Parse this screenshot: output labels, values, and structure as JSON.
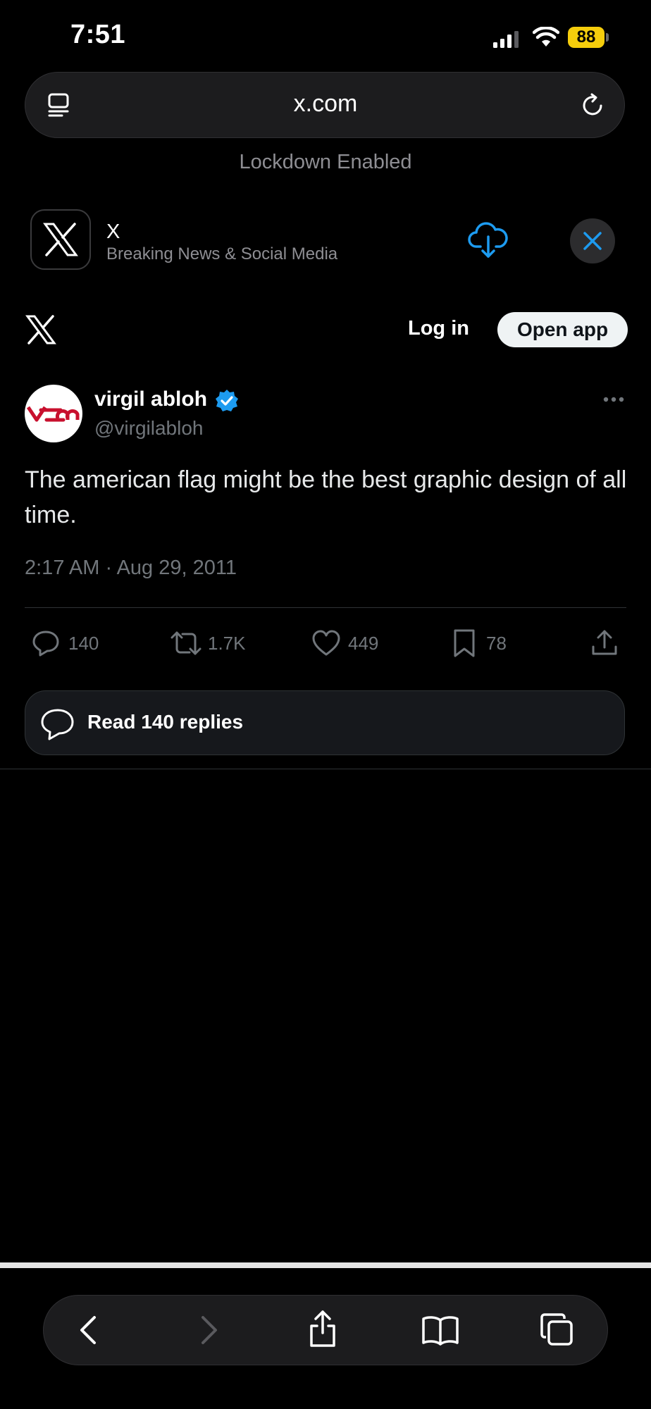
{
  "status_bar": {
    "time": "7:51",
    "battery": "88"
  },
  "browser": {
    "url": "x.com",
    "lockdown_notice": "Lockdown Enabled"
  },
  "app_banner": {
    "name": "X",
    "subtitle": "Breaking News & Social Media"
  },
  "header": {
    "login_label": "Log in",
    "open_app_label": "Open app"
  },
  "tweet": {
    "display_name": "virgil abloh",
    "handle": "@virgilabloh",
    "text": "The american flag might be the best graphic design of all time.",
    "timestamp": "2:17 AM · Aug 29, 2011",
    "stats": {
      "replies": "140",
      "reposts": "1.7K",
      "likes": "449",
      "bookmarks": "78"
    },
    "read_replies_label": "Read 140 replies"
  },
  "colors": {
    "accent_blue": "#1d9bf0",
    "verified_badge": "#1d9bf0",
    "battery": "#f5cd0c"
  },
  "icons": [
    "tabs-sidebar-icon",
    "reload-icon",
    "x-logo-icon",
    "cloud-download-icon",
    "close-icon",
    "verified-badge-icon",
    "more-icon",
    "reply-icon",
    "repost-icon",
    "like-icon",
    "bookmark-icon",
    "share-icon",
    "back-icon",
    "forward-icon",
    "share-sheet-icon",
    "bookmarks-book-icon",
    "tabs-icon"
  ]
}
